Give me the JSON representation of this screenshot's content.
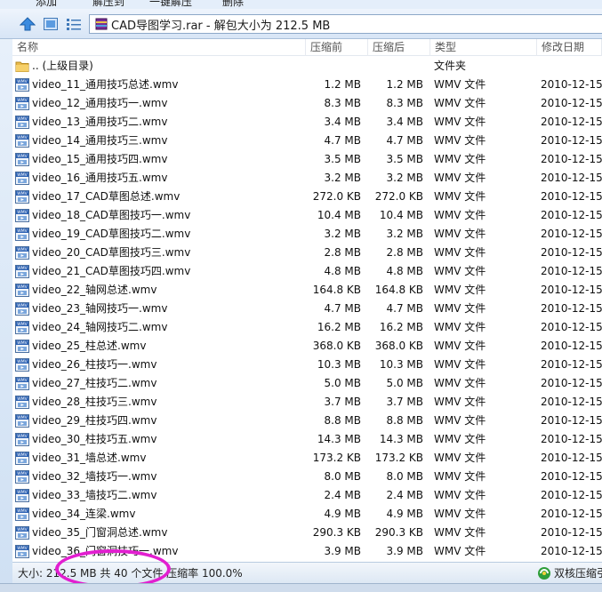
{
  "toolbar": {
    "items": [
      "添加",
      "解压到",
      "一键解压",
      "删除"
    ]
  },
  "address": {
    "text": "CAD导图学习.rar - 解包大小为 212.5 MB"
  },
  "columns": {
    "name": "名称",
    "size": "压缩前",
    "packed": "压缩后",
    "type": "类型",
    "modified": "修改日期"
  },
  "rows": [
    {
      "name": ".. (上级目录)",
      "size": "",
      "packed": "",
      "type": "文件夹",
      "date": "",
      "icon": "folder-icon"
    },
    {
      "name": "video_11_通用技巧总述.wmv",
      "size": "1.2 MB",
      "packed": "1.2 MB",
      "type": "WMV 文件",
      "date": "2010-12-15",
      "icon": "wmv-file-icon"
    },
    {
      "name": "video_12_通用技巧一.wmv",
      "size": "8.3 MB",
      "packed": "8.3 MB",
      "type": "WMV 文件",
      "date": "2010-12-15",
      "icon": "wmv-file-icon"
    },
    {
      "name": "video_13_通用技巧二.wmv",
      "size": "3.4 MB",
      "packed": "3.4 MB",
      "type": "WMV 文件",
      "date": "2010-12-15",
      "icon": "wmv-file-icon"
    },
    {
      "name": "video_14_通用技巧三.wmv",
      "size": "4.7 MB",
      "packed": "4.7 MB",
      "type": "WMV 文件",
      "date": "2010-12-15",
      "icon": "wmv-file-icon"
    },
    {
      "name": "video_15_通用技巧四.wmv",
      "size": "3.5 MB",
      "packed": "3.5 MB",
      "type": "WMV 文件",
      "date": "2010-12-15",
      "icon": "wmv-file-icon"
    },
    {
      "name": "video_16_通用技巧五.wmv",
      "size": "3.2 MB",
      "packed": "3.2 MB",
      "type": "WMV 文件",
      "date": "2010-12-15",
      "icon": "wmv-file-icon"
    },
    {
      "name": "video_17_CAD草图总述.wmv",
      "size": "272.0 KB",
      "packed": "272.0 KB",
      "type": "WMV 文件",
      "date": "2010-12-15",
      "icon": "wmv-file-icon"
    },
    {
      "name": "video_18_CAD草图技巧一.wmv",
      "size": "10.4 MB",
      "packed": "10.4 MB",
      "type": "WMV 文件",
      "date": "2010-12-15",
      "icon": "wmv-file-icon"
    },
    {
      "name": "video_19_CAD草图技巧二.wmv",
      "size": "3.2 MB",
      "packed": "3.2 MB",
      "type": "WMV 文件",
      "date": "2010-12-15",
      "icon": "wmv-file-icon"
    },
    {
      "name": "video_20_CAD草图技巧三.wmv",
      "size": "2.8 MB",
      "packed": "2.8 MB",
      "type": "WMV 文件",
      "date": "2010-12-15",
      "icon": "wmv-file-icon"
    },
    {
      "name": "video_21_CAD草图技巧四.wmv",
      "size": "4.8 MB",
      "packed": "4.8 MB",
      "type": "WMV 文件",
      "date": "2010-12-15",
      "icon": "wmv-file-icon"
    },
    {
      "name": "video_22_轴网总述.wmv",
      "size": "164.8 KB",
      "packed": "164.8 KB",
      "type": "WMV 文件",
      "date": "2010-12-15",
      "icon": "wmv-file-icon"
    },
    {
      "name": "video_23_轴网技巧一.wmv",
      "size": "4.7 MB",
      "packed": "4.7 MB",
      "type": "WMV 文件",
      "date": "2010-12-15",
      "icon": "wmv-file-icon"
    },
    {
      "name": "video_24_轴网技巧二.wmv",
      "size": "16.2 MB",
      "packed": "16.2 MB",
      "type": "WMV 文件",
      "date": "2010-12-15",
      "icon": "wmv-file-icon"
    },
    {
      "name": "video_25_柱总述.wmv",
      "size": "368.0 KB",
      "packed": "368.0 KB",
      "type": "WMV 文件",
      "date": "2010-12-15",
      "icon": "wmv-file-icon"
    },
    {
      "name": "video_26_柱技巧一.wmv",
      "size": "10.3 MB",
      "packed": "10.3 MB",
      "type": "WMV 文件",
      "date": "2010-12-15",
      "icon": "wmv-file-icon"
    },
    {
      "name": "video_27_柱技巧二.wmv",
      "size": "5.0 MB",
      "packed": "5.0 MB",
      "type": "WMV 文件",
      "date": "2010-12-15",
      "icon": "wmv-file-icon"
    },
    {
      "name": "video_28_柱技巧三.wmv",
      "size": "3.7 MB",
      "packed": "3.7 MB",
      "type": "WMV 文件",
      "date": "2010-12-15",
      "icon": "wmv-file-icon"
    },
    {
      "name": "video_29_柱技巧四.wmv",
      "size": "8.8 MB",
      "packed": "8.8 MB",
      "type": "WMV 文件",
      "date": "2010-12-15",
      "icon": "wmv-file-icon"
    },
    {
      "name": "video_30_柱技巧五.wmv",
      "size": "14.3 MB",
      "packed": "14.3 MB",
      "type": "WMV 文件",
      "date": "2010-12-15",
      "icon": "wmv-file-icon"
    },
    {
      "name": "video_31_墙总述.wmv",
      "size": "173.2 KB",
      "packed": "173.2 KB",
      "type": "WMV 文件",
      "date": "2010-12-15",
      "icon": "wmv-file-icon"
    },
    {
      "name": "video_32_墙技巧一.wmv",
      "size": "8.0 MB",
      "packed": "8.0 MB",
      "type": "WMV 文件",
      "date": "2010-12-15",
      "icon": "wmv-file-icon"
    },
    {
      "name": "video_33_墙技巧二.wmv",
      "size": "2.4 MB",
      "packed": "2.4 MB",
      "type": "WMV 文件",
      "date": "2010-12-15",
      "icon": "wmv-file-icon"
    },
    {
      "name": "video_34_连梁.wmv",
      "size": "4.9 MB",
      "packed": "4.9 MB",
      "type": "WMV 文件",
      "date": "2010-12-15",
      "icon": "wmv-file-icon"
    },
    {
      "name": "video_35_门窗洞总述.wmv",
      "size": "290.3 KB",
      "packed": "290.3 KB",
      "type": "WMV 文件",
      "date": "2010-12-15",
      "icon": "wmv-file-icon"
    },
    {
      "name": "video_36_门窗洞技巧一.wmv",
      "size": "3.9 MB",
      "packed": "3.9 MB",
      "type": "WMV 文件",
      "date": "2010-12-15",
      "icon": "wmv-file-icon"
    }
  ],
  "status": {
    "text": "大小: 212.5 MB 共 40 个文件 压缩率 100.0%",
    "brand": "双核压缩引擎"
  },
  "colors": {
    "highlight": "#e21fd0",
    "accent": "#3a7fd5"
  }
}
